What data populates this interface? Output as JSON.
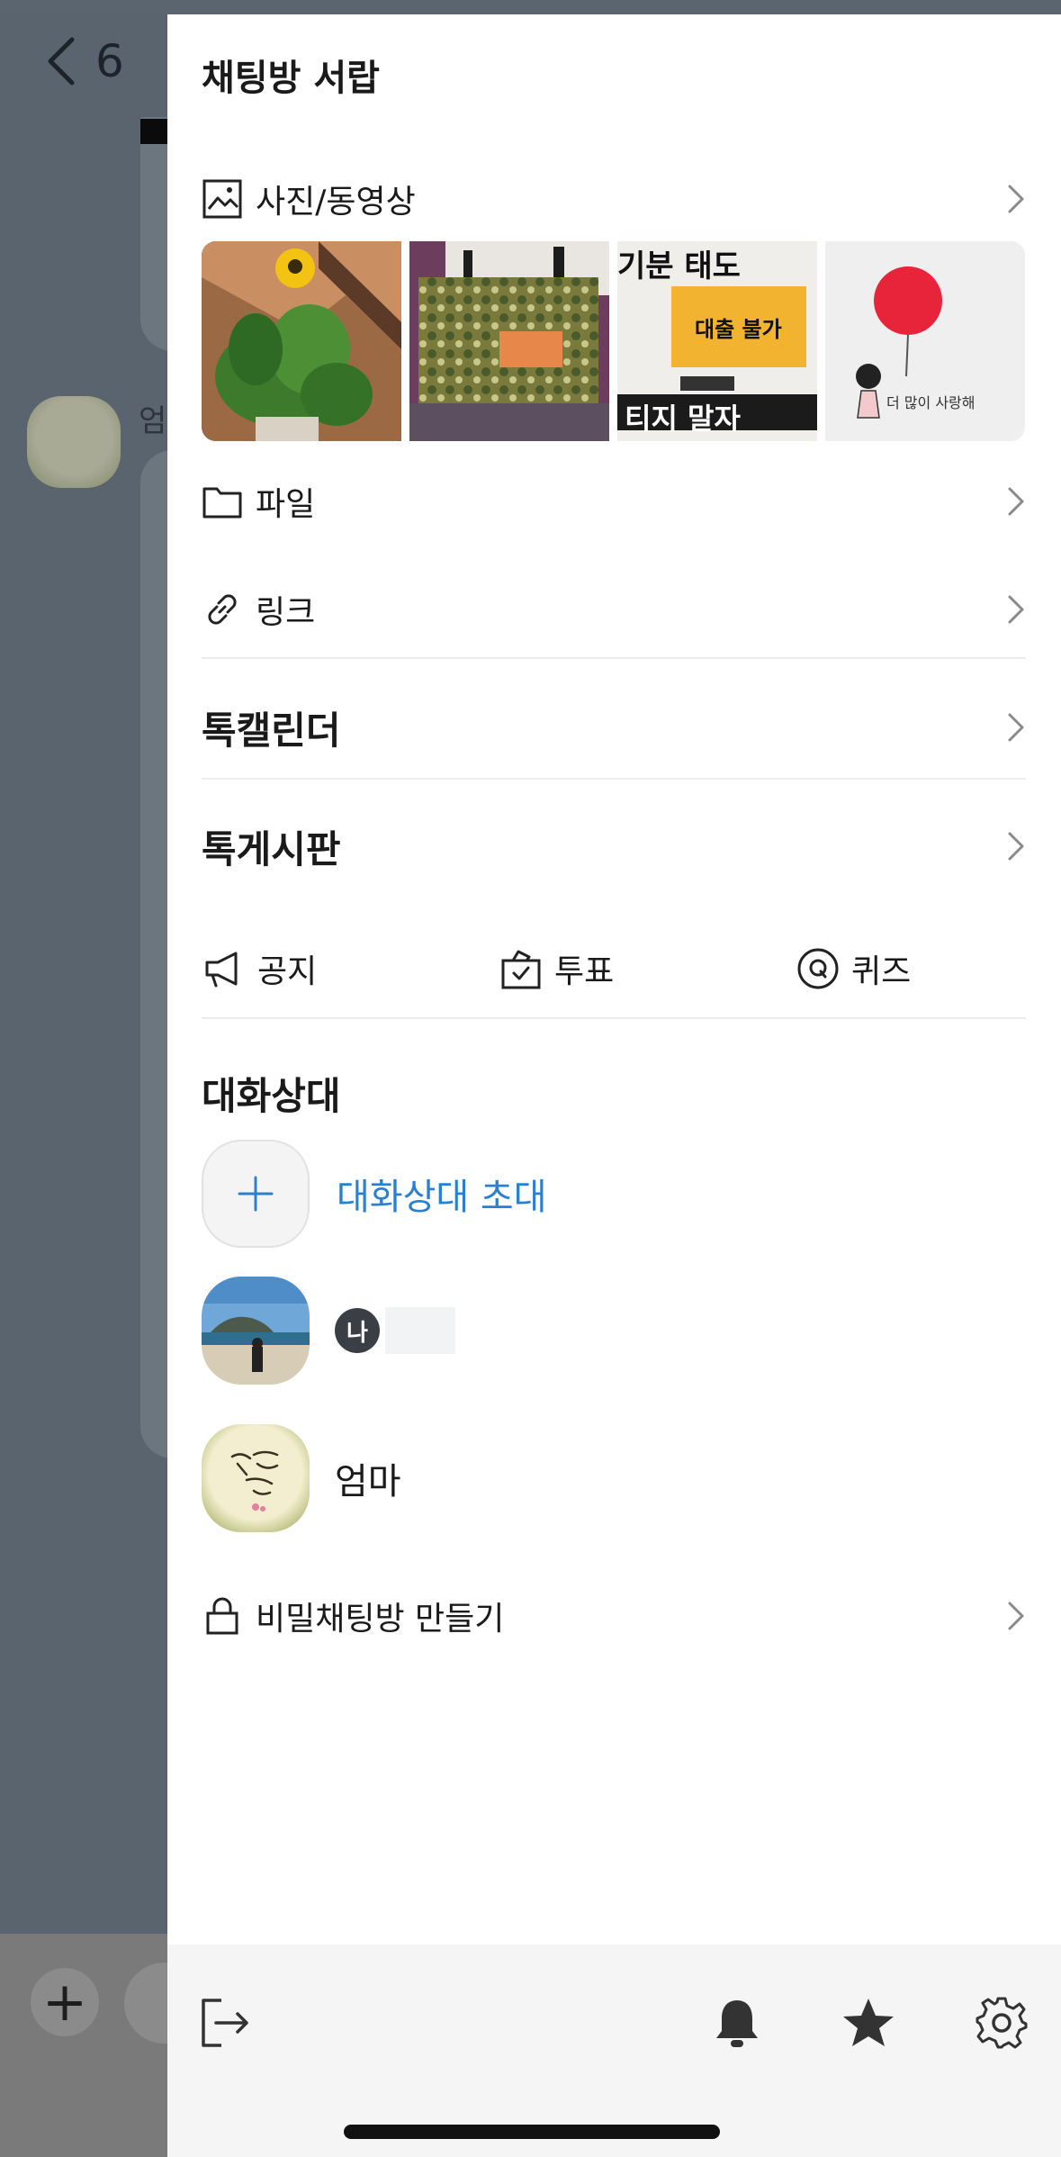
{
  "background": {
    "back_count": "6",
    "sender_initial": "엄"
  },
  "drawer": {
    "title": "채팅방 서랍",
    "media": {
      "label": "사진/동영상",
      "icon": "photo-icon"
    },
    "files": {
      "label": "파일",
      "icon": "folder-icon"
    },
    "links": {
      "label": "링크",
      "icon": "link-icon"
    },
    "calendar": {
      "label": "톡캘린더"
    },
    "board": {
      "label": "톡게시판"
    },
    "quick": {
      "notice": "공지",
      "vote": "투표",
      "quiz": "퀴즈"
    },
    "members_title": "대화상대",
    "invite_label": "대화상대 초대",
    "me_badge": "나",
    "members": [
      {
        "name": "엄마"
      }
    ],
    "secret_chat": "비밀채팅방 만들기"
  },
  "thumbs": {
    "thumb3_top": "기분 태도",
    "thumb3_mid": "대출 불가",
    "thumb3_bottom": "티지 말자",
    "thumb4_caption": "더 많이 사랑해"
  },
  "colors": {
    "accent": "#2a7fd0",
    "drawer_bg": "#ffffff",
    "overlay": "#59646e",
    "bottom_bar": "#f5f5f5"
  }
}
